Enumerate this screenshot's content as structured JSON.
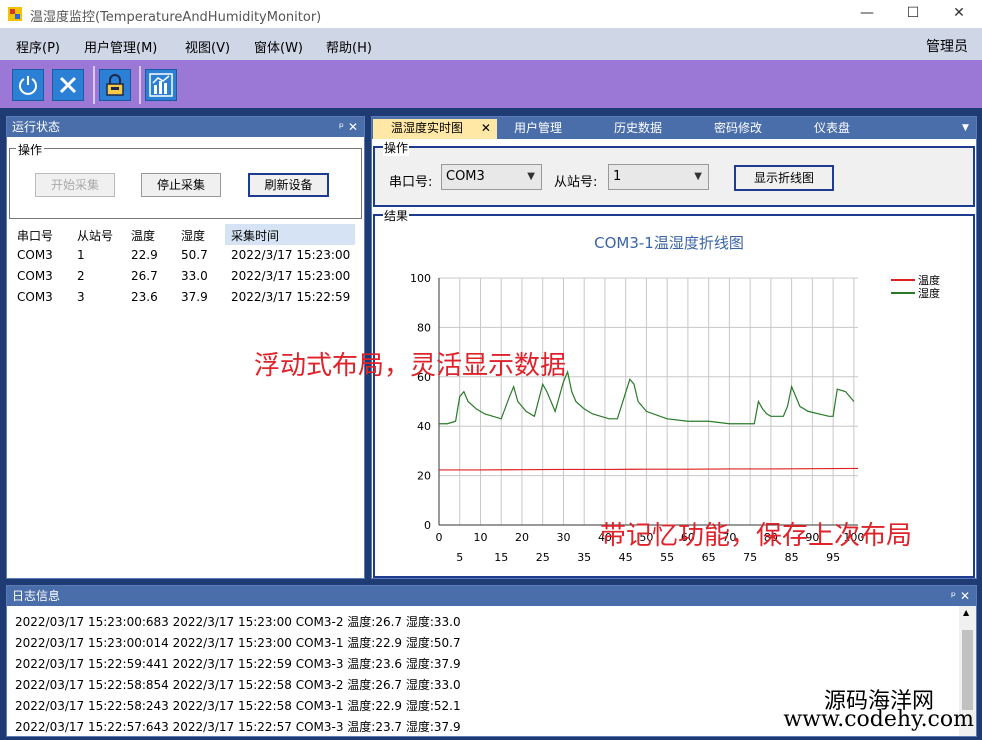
{
  "window": {
    "title": "温湿度监控(TemperatureAndHumidityMonitor)",
    "minimize": "—",
    "maximize": "☐",
    "close": "✕"
  },
  "menu": {
    "items": [
      "程序(P)",
      "用户管理(M)",
      "视图(V)",
      "窗体(W)",
      "帮助(H)"
    ],
    "user_role": "管理员"
  },
  "toolbar": {
    "icons": [
      "power-icon",
      "close-x-icon",
      "lock-icon",
      "chart-icon"
    ]
  },
  "run_status": {
    "title": "运行状态",
    "group_label": "操作",
    "btn_start": "开始采集",
    "btn_stop": "停止采集",
    "btn_refresh": "刷新设备",
    "columns": [
      "串口号",
      "从站号",
      "温度",
      "湿度",
      "采集时间"
    ],
    "rows": [
      [
        "COM3",
        "1",
        "22.9",
        "50.7",
        "2022/3/17 15:23:00"
      ],
      [
        "COM3",
        "2",
        "26.7",
        "33.0",
        "2022/3/17 15:23:00"
      ],
      [
        "COM3",
        "3",
        "23.6",
        "37.9",
        "2022/3/17 15:22:59"
      ]
    ]
  },
  "tabs": {
    "items": [
      "温湿度实时图",
      "用户管理",
      "历史数据",
      "密码修改",
      "仪表盘"
    ],
    "active_close": "✕",
    "overflow": "▼"
  },
  "operation": {
    "label": "操作",
    "port_label": "串口号:",
    "port_value": "COM3",
    "slave_label": "从站号:",
    "slave_value": "1",
    "show_chart_btn": "显示折线图"
  },
  "result_label": "结果",
  "chart_data": {
    "type": "line",
    "title": "COM3-1温湿度折线图",
    "xlim": [
      0,
      101
    ],
    "ylim": [
      0,
      100
    ],
    "x_ticks_top": [
      "0",
      "10",
      "20",
      "30",
      "40",
      "50",
      "60",
      "70",
      "80",
      "90",
      "100"
    ],
    "x_ticks_bottom": [
      "5",
      "15",
      "25",
      "35",
      "45",
      "55",
      "65",
      "75",
      "85",
      "95"
    ],
    "y_ticks": [
      "0",
      "20",
      "40",
      "60",
      "80",
      "100"
    ],
    "legend_position": "top-right",
    "colors": {
      "temperature": "#e02020",
      "humidity": "#2a7a2a"
    },
    "series": [
      {
        "name": "温度",
        "x": [
          0,
          10,
          20,
          30,
          40,
          50,
          60,
          70,
          80,
          90,
          101
        ],
        "values": [
          22.3,
          22.3,
          22.4,
          22.5,
          22.5,
          22.6,
          22.6,
          22.7,
          22.7,
          22.8,
          22.9
        ]
      },
      {
        "name": "湿度",
        "x": [
          0,
          2,
          4,
          5,
          6,
          7,
          9,
          11,
          13,
          15,
          17,
          18,
          19,
          21,
          23,
          25,
          26,
          28,
          30,
          31,
          32,
          33,
          35,
          37,
          39,
          41,
          42,
          43,
          46,
          47,
          48,
          50,
          55,
          60,
          65,
          70,
          75,
          76,
          77,
          78,
          79,
          80,
          83,
          84,
          85,
          87,
          89,
          94,
          95,
          96,
          98,
          100
        ],
        "values": [
          41,
          41,
          42,
          52,
          54,
          50,
          47,
          45,
          44,
          43,
          52,
          56,
          50,
          46,
          44,
          57,
          54,
          46,
          58,
          62,
          54,
          50,
          47,
          45,
          44,
          43,
          43,
          43,
          59,
          57,
          50,
          46,
          43,
          42,
          42,
          41,
          41,
          41,
          50,
          47,
          45,
          44,
          44,
          48,
          56,
          48,
          46,
          44,
          44,
          55,
          54,
          50
        ]
      }
    ]
  },
  "overlay": {
    "text1": "浮动式布局，灵活显示数据",
    "text2": "带记忆功能，保存上次布局"
  },
  "log": {
    "title": "日志信息",
    "lines": [
      "2022/03/17 15:23:00:683  2022/3/17 15:23:00 COM3-2 温度:26.7 湿度:33.0",
      "2022/03/17 15:23:00:014  2022/3/17 15:23:00 COM3-1 温度:22.9 湿度:50.7",
      "2022/03/17 15:22:59:441  2022/3/17 15:22:59 COM3-3 温度:23.6 湿度:37.9",
      "2022/03/17 15:22:58:854  2022/3/17 15:22:58 COM3-2 温度:26.7 湿度:33.0",
      "2022/03/17 15:22:58:243  2022/3/17 15:22:58 COM3-1 温度:22.9 湿度:52.1",
      "2022/03/17 15:22:57:643  2022/3/17 15:22:57 COM3-3 温度:23.7 湿度:37.9"
    ]
  },
  "watermark": {
    "line1": "源码海洋网",
    "line2": "www.codehy.com"
  }
}
